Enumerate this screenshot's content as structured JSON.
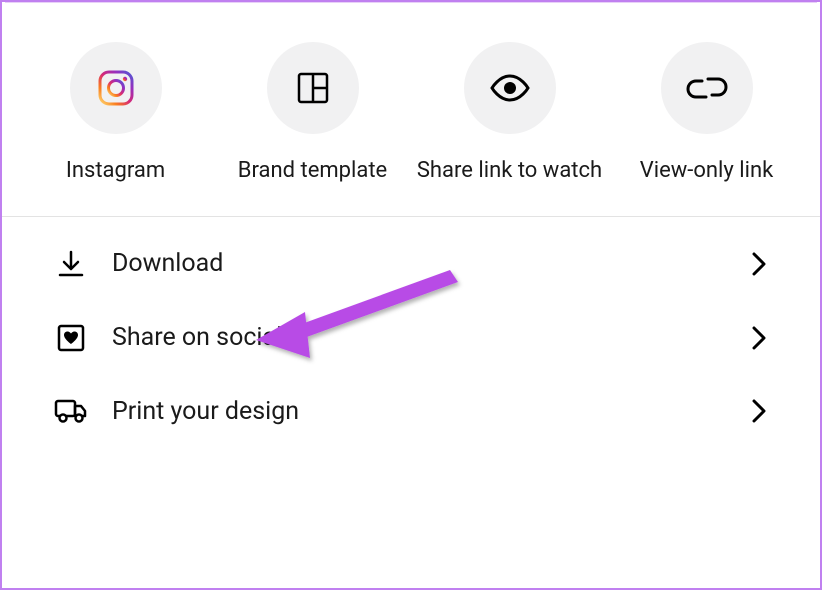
{
  "share_options": [
    {
      "label": "Instagram"
    },
    {
      "label": "Brand template"
    },
    {
      "label": "Share link to watch"
    },
    {
      "label": "View-only link"
    }
  ],
  "actions": [
    {
      "label": "Download"
    },
    {
      "label": "Share on social"
    },
    {
      "label": "Print your design"
    }
  ]
}
